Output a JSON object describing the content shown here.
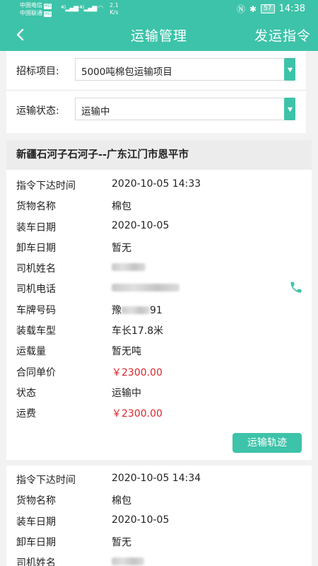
{
  "status_bar": {
    "carrier1": "中国电信",
    "carrier2": "中国联通",
    "hd": "HD",
    "net1": "4G",
    "net2": "4G",
    "speed_value": "2.1",
    "speed_unit": "K/s",
    "battery": "57",
    "time": "14:38"
  },
  "header": {
    "title": "运输管理",
    "action_label": "发运指令"
  },
  "filters": {
    "project_label": "招标项目:",
    "project_value": "5000吨棉包运输项目",
    "status_label": "运输状态:",
    "status_value": "运输中"
  },
  "labels": {
    "order_time": "指令下达时间",
    "goods": "货物名称",
    "load_date": "装车日期",
    "unload_date": "卸车日期",
    "driver_name": "司机姓名",
    "driver_phone": "司机电话",
    "plate": "车牌号码",
    "vehicle_type": "装载车型",
    "volume": "运载量",
    "unit_price": "合同单价",
    "status": "状态",
    "fee": "运费"
  },
  "orders": [
    {
      "route": "新疆石河子石河子--广东江门市恩平市",
      "order_time": "2020-10-05 14:33",
      "goods": "棉包",
      "load_date": "2020-10-05",
      "unload_date": "暂无",
      "plate_prefix": "豫",
      "plate_suffix": "91",
      "vehicle_type": "车长17.8米",
      "volume": "暂无吨",
      "unit_price": "￥2300.00",
      "status": "运输中",
      "fee": "￥2300.00",
      "track_label": "运输轨迹"
    },
    {
      "order_time": "2020-10-05 14:34",
      "goods": "棉包",
      "load_date": "2020-10-05",
      "unload_date": "暂无"
    }
  ],
  "colors": {
    "accent": "#3dc3a9",
    "price": "#d9262c"
  },
  "icons": [
    "back-arrow-icon",
    "dropdown-arrow-icon",
    "phone-icon"
  ]
}
